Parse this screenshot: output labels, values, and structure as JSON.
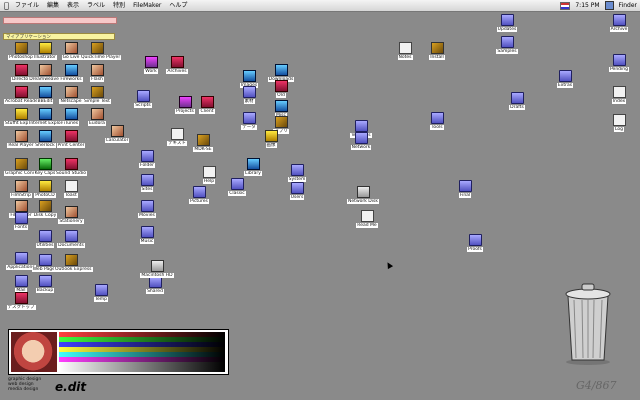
{
  "menubar": {
    "apple": "",
    "items": [
      "ファイル",
      "編集",
      "表示",
      "ラベル",
      "特別",
      "FileMaker",
      "ヘルプ"
    ],
    "clock": "7:15 PM",
    "app": "Finder"
  },
  "launcher": {
    "title": "マイアプリケーション"
  },
  "icons": [
    {
      "label": "Photoshop",
      "kind": "app"
    },
    {
      "label": "Illustrator",
      "kind": "yellow"
    },
    {
      "label": "Go Live",
      "kind": "photo"
    },
    {
      "label": "QuickTime Player",
      "kind": "app"
    },
    {
      "label": "Director",
      "kind": "red"
    },
    {
      "label": "Dreamweaver",
      "kind": "photo"
    },
    {
      "label": "Fireworks",
      "kind": "blue"
    },
    {
      "label": "Flash",
      "kind": "photo"
    },
    {
      "label": "Acrobat Reader",
      "kind": "red"
    },
    {
      "label": "BBEdit",
      "kind": "blue"
    },
    {
      "label": "Netscape",
      "kind": "photo"
    },
    {
      "label": "Simple Text",
      "kind": "app"
    },
    {
      "label": "Stuffit Expander",
      "kind": "yellow"
    },
    {
      "label": "Internet Explorer",
      "kind": "blue"
    },
    {
      "label": "iTunes",
      "kind": "blue"
    },
    {
      "label": "Eudora",
      "kind": "photo"
    },
    {
      "label": "Real Player",
      "kind": "photo"
    },
    {
      "label": "Sherlock",
      "kind": "blue"
    },
    {
      "label": "Print Center",
      "kind": "red"
    },
    {
      "label": "Calculator",
      "kind": "photo"
    },
    {
      "label": "Graphic Converter",
      "kind": "app"
    },
    {
      "label": "Key Caps",
      "kind": "green"
    },
    {
      "label": "Sound Studio",
      "kind": "red"
    },
    {
      "label": "FilmStrip",
      "kind": "photo"
    },
    {
      "label": "PhotoCD",
      "kind": "yellow"
    },
    {
      "label": "Toast",
      "kind": "doc"
    },
    {
      "label": "FileMaker",
      "kind": "photo"
    },
    {
      "label": "Disk Copy",
      "kind": "app"
    },
    {
      "label": "Stationery",
      "kind": "photo"
    },
    {
      "label": "Fonts",
      "kind": "folder"
    },
    {
      "label": "Utilities",
      "kind": "folder"
    },
    {
      "label": "Documents",
      "kind": "folder"
    },
    {
      "label": "Applications",
      "kind": "folder"
    },
    {
      "label": "Web Pages",
      "kind": "folder"
    },
    {
      "label": "Outlook Express",
      "kind": "app"
    },
    {
      "label": "Mail",
      "kind": "folder"
    },
    {
      "label": "Backup",
      "kind": "folder"
    },
    {
      "label": "デスクトップ",
      "kind": "red"
    },
    {
      "label": "Work",
      "kind": "magenta"
    },
    {
      "label": "Archives",
      "kind": "red"
    },
    {
      "label": "Images",
      "kind": "blue"
    },
    {
      "label": "Scripts",
      "kind": "folder"
    },
    {
      "label": "Projects",
      "kind": "magenta"
    },
    {
      "label": "Client",
      "kind": "red"
    },
    {
      "label": "素材",
      "kind": "folder"
    },
    {
      "label": "Downloads",
      "kind": "blue"
    },
    {
      "label": "Old",
      "kind": "red"
    },
    {
      "label": "Misc",
      "kind": "blue"
    },
    {
      "label": "アプリ",
      "kind": "app"
    },
    {
      "label": "データ",
      "kind": "folder"
    },
    {
      "label": "画像",
      "kind": "yellow"
    },
    {
      "label": "テキスト",
      "kind": "doc"
    },
    {
      "label": "MDK-SE",
      "kind": "app"
    },
    {
      "label": "Help",
      "kind": "doc"
    },
    {
      "label": "Folder",
      "kind": "folder"
    },
    {
      "label": "Sites",
      "kind": "folder"
    },
    {
      "label": "Movies",
      "kind": "folder"
    },
    {
      "label": "Music",
      "kind": "folder"
    },
    {
      "label": "Pictures",
      "kind": "folder"
    },
    {
      "label": "Library",
      "kind": "blue"
    },
    {
      "label": "System",
      "kind": "folder"
    },
    {
      "label": "Users",
      "kind": "folder"
    },
    {
      "label": "Volumes",
      "kind": "folder"
    },
    {
      "label": "Network",
      "kind": "folder"
    },
    {
      "label": "Classic",
      "kind": "folder"
    },
    {
      "label": "Temp",
      "kind": "folder"
    },
    {
      "label": "Shared",
      "kind": "folder"
    },
    {
      "label": "Macintosh HD",
      "kind": "disk"
    },
    {
      "label": "Network Disk",
      "kind": "disk"
    },
    {
      "label": "Read Me",
      "kind": "doc"
    },
    {
      "label": "Notes",
      "kind": "doc"
    },
    {
      "label": "Install",
      "kind": "app"
    },
    {
      "label": "Updates",
      "kind": "folder"
    },
    {
      "label": "Samples",
      "kind": "folder"
    },
    {
      "label": "Extras",
      "kind": "folder"
    },
    {
      "label": "Tools",
      "kind": "folder"
    },
    {
      "label": "Drafts",
      "kind": "folder"
    },
    {
      "label": "Proofs",
      "kind": "folder"
    },
    {
      "label": "Final",
      "kind": "folder"
    },
    {
      "label": "Archive",
      "kind": "folder"
    },
    {
      "label": "Pending",
      "kind": "folder"
    },
    {
      "label": "Index",
      "kind": "doc"
    },
    {
      "label": "Log",
      "kind": "doc"
    }
  ],
  "banner": {
    "stripes": [
      "#ff4040",
      "#40ff40",
      "#4040ff",
      "#ffff40",
      "#40ffff",
      "#ff40ff",
      "#ffffff"
    ]
  },
  "footer": {
    "credit": "graphic design\nweb design\nmedia design",
    "logo": "e.dit",
    "model": "G4/867"
  }
}
